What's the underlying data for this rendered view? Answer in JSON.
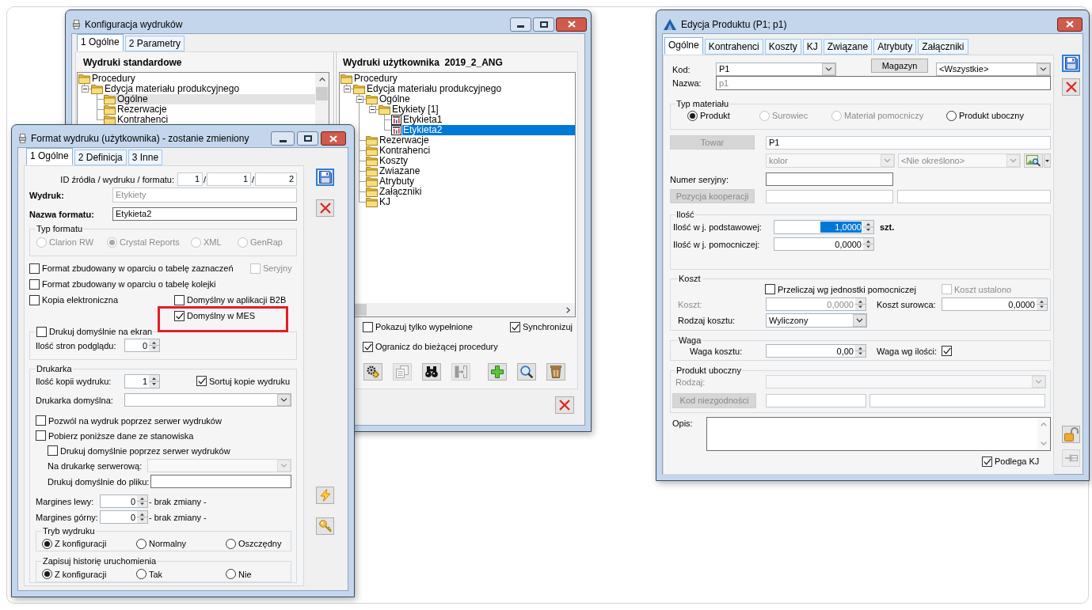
{
  "config_window": {
    "title": "Konfiguracja wydruków",
    "tabs": [
      {
        "label": "1 Ogólne",
        "selected": true
      },
      {
        "label": "2 Parametry",
        "selected": false
      }
    ],
    "standard_prints": {
      "title": "Wydruki standardowe",
      "focused": false,
      "tree": [
        {
          "label": "Procedury",
          "kind": "folder",
          "selected": false,
          "children": [
            {
              "label": "Edycja materiału produkcyjnego",
              "kind": "folder",
              "expanded": true,
              "selected": false,
              "children": [
                {
                  "label": "Ogólne",
                  "kind": "folder",
                  "selected": true
                },
                {
                  "label": "Rezerwacje",
                  "kind": "folder",
                  "selected": false
                },
                {
                  "label": "Kontrahenci",
                  "kind": "folder",
                  "selected": false
                }
              ]
            }
          ]
        }
      ]
    },
    "user_prints": {
      "title": "Wydruki użytkownika  2019_2_ANG",
      "focused": true,
      "tree": [
        {
          "label": "Procedury",
          "kind": "folder",
          "selected": false,
          "children": [
            {
              "label": "Edycja materiału produkcyjnego",
              "kind": "folder",
              "expanded": true,
              "selected": false,
              "children": [
                {
                  "label": "Ogólne",
                  "kind": "folder",
                  "expanded": true,
                  "selected": false,
                  "children": [
                    {
                      "label": "Etykiety [1]",
                      "kind": "folder",
                      "expanded": true,
                      "selected": false,
                      "children": [
                        {
                          "label": "Etykieta1",
                          "kind": "report",
                          "selected": false
                        },
                        {
                          "label": "Etykieta2",
                          "kind": "report",
                          "selected": true
                        }
                      ]
                    }
                  ]
                },
                {
                  "label": "Rezerwacje",
                  "kind": "folder",
                  "selected": false
                },
                {
                  "label": "Kontrahenci",
                  "kind": "folder",
                  "selected": false
                },
                {
                  "label": "Koszty",
                  "kind": "folder",
                  "selected": false
                },
                {
                  "label": "Zwiazane",
                  "kind": "folder",
                  "selected": false
                },
                {
                  "label": "Atrybuty",
                  "kind": "folder",
                  "selected": false
                },
                {
                  "label": "Załączniki",
                  "kind": "folder",
                  "selected": false
                },
                {
                  "label": "KJ",
                  "kind": "folder",
                  "selected": false
                }
              ]
            }
          ]
        }
      ]
    },
    "options": [
      {
        "label": "Pokazuj tylko wypełnione",
        "checked": false
      },
      {
        "label": "Synchronizuj",
        "checked": true
      },
      {
        "label": "Ogranicz do bieżącej procedury",
        "checked": true
      }
    ],
    "toolbar": [
      {
        "kind": "gears",
        "disabled": false
      },
      {
        "kind": "copy",
        "disabled": true
      },
      {
        "kind": "binoculars",
        "disabled": false
      },
      {
        "kind": "connect",
        "disabled": true
      },
      {
        "kind": "add",
        "disabled": false
      },
      {
        "kind": "search",
        "disabled": false
      },
      {
        "kind": "delete",
        "disabled": false
      }
    ]
  },
  "format_window": {
    "title": "Format wydruku (użytkownika) - zostanie zmieniony",
    "tabs": [
      {
        "label": "1 Ogólne",
        "selected": true
      },
      {
        "label": "2 Definicja",
        "selected": false
      },
      {
        "label": "3 Inne",
        "selected": false
      }
    ],
    "id": {
      "label": "ID źródła / wydruku / formatu:",
      "fields": [
        {
          "value": "1",
          "separator": "/"
        },
        {
          "value": "1",
          "separator": "/"
        },
        {
          "value": "2"
        }
      ]
    },
    "print": {
      "label": "Wydruk:",
      "value": "Etykiety",
      "disabled": true
    },
    "format_name": {
      "label": "Nazwa formatu:",
      "value": "Etykieta2",
      "disabled": false
    },
    "format_type": {
      "title": "Typ formatu",
      "disabled": true,
      "options": [
        {
          "label": "Clarion RW",
          "selected": false
        },
        {
          "label": "Crystal Reports",
          "selected": true
        },
        {
          "label": "XML",
          "selected": false
        },
        {
          "label": "GenRap",
          "selected": false
        }
      ]
    },
    "flags": [
      {
        "label": "Format zbudowany w oparciu o tabelę zaznaczeń",
        "checked": false,
        "disabled": false
      },
      {
        "label": "Seryjny",
        "checked": false,
        "disabled": true
      },
      {
        "label": "Format zbudowany w oparciu o tabelę kolejki",
        "checked": false,
        "disabled": false
      },
      {
        "label": "Kopia elektroniczna",
        "checked": false,
        "disabled": false
      },
      {
        "label": "Domyślny w aplikacji B2B",
        "checked": false,
        "disabled": false
      },
      {
        "label": "Domyślny w MES",
        "checked": true,
        "disabled": false,
        "highlighted": true
      }
    ],
    "screen": {
      "label": "Drukuj domyślnie na ekran",
      "checked": false,
      "pages_label": "Ilość stron podglądu:",
      "pages_value": "0"
    },
    "printer": {
      "title": "Drukarka",
      "copies_label": "Ilość kopii wydruku:",
      "copies_value": "1",
      "sort_copies": {
        "label": "Sortuj kopie wydruku",
        "checked": true
      },
      "default_printer_label": "Drukarka domyślna:",
      "server_options": [
        {
          "label": "Pozwól na wydruk poprzez serwer wydruków",
          "checked": false
        },
        {
          "label": "Pobierz poniższe dane ze stanowiska",
          "checked": false
        },
        {
          "label": "Drukuj domyślnie poprzez serwer wydruków",
          "checked": false
        }
      ],
      "server_printer": {
        "label": "Na drukarkę serwerową:",
        "disabled": true
      },
      "file_label": "Drukuj domyślnie do pliku:",
      "margins": [
        {
          "label": "Margines lewy:",
          "value": "0",
          "note": "- brak zmiany -"
        },
        {
          "label": "Margines górny:",
          "value": "0",
          "note": "- brak zmiany -"
        }
      ],
      "print_mode": {
        "title": "Tryb wydruku",
        "options": [
          {
            "label": "Z konfiguracji",
            "selected": true
          },
          {
            "label": "Normalny",
            "selected": false
          },
          {
            "label": "Oszczędny",
            "selected": false
          }
        ]
      },
      "run_history": {
        "title": "Zapisuj historię uruchomienia",
        "options": [
          {
            "label": "Z konfiguracji",
            "selected": true
          },
          {
            "label": "Tak",
            "selected": false
          },
          {
            "label": "Nie",
            "selected": false
          }
        ]
      }
    },
    "side_buttons": [
      {
        "kind": "save",
        "disabled": false
      },
      {
        "kind": "cancel",
        "disabled": false
      },
      {
        "kind": "bolt",
        "disabled": false
      },
      {
        "kind": "key",
        "disabled": false
      }
    ]
  },
  "product_window": {
    "title": "Edycja Produktu (P1; p1)",
    "tabs": [
      {
        "label": "Ogólne",
        "selected": true
      },
      {
        "label": "Kontrahenci",
        "selected": false
      },
      {
        "label": "Koszty",
        "selected": false
      },
      {
        "label": "KJ",
        "selected": false
      },
      {
        "label": "Związane",
        "selected": false
      },
      {
        "label": "Atrybuty",
        "selected": false
      },
      {
        "label": "Załączniki",
        "selected": false
      }
    ],
    "code": {
      "label": "Kod:",
      "value": "P1"
    },
    "warehouse_button": "Magazyn",
    "warehouse": "<Wszystkie>",
    "name": {
      "label": "Nazwa:",
      "value": "p1",
      "disabled": true
    },
    "material_type": {
      "title": "Typ materiału",
      "options": [
        {
          "label": "Produkt",
          "selected": true,
          "disabled": false
        },
        {
          "label": "Surowiec",
          "selected": false,
          "disabled": true
        },
        {
          "label": "Materiał pomocniczy",
          "selected": false,
          "disabled": true
        },
        {
          "label": "Produkt uboczny",
          "selected": false,
          "disabled": false
        }
      ]
    },
    "item": {
      "button": "Towar",
      "disabled": true,
      "value": "P1"
    },
    "feature": {
      "name": "kolor",
      "value": "<Nie określono>",
      "disabled": true
    },
    "serial_label": "Numer seryjny:",
    "cooperation": {
      "button": "Pozycja kooperacji",
      "disabled": true
    },
    "quantity": {
      "title": "Ilość",
      "base_label": "Ilość w j. podstawowej:",
      "base_value": "1,0000",
      "base_selected": true,
      "unit": "szt.",
      "aux_label": "Ilość w j. pomocniczej:",
      "aux_value": "0,0000"
    },
    "cost": {
      "title": "Koszt",
      "convert": {
        "label": "Przeliczaj wg jednostki pomocniczej",
        "checked": false,
        "disabled": false
      },
      "fixed": {
        "label": "Koszt ustalono",
        "checked": false,
        "disabled": true
      },
      "cost_label": "Koszt:",
      "cost_value": "0,0000",
      "cost_disabled": true,
      "raw_label": "Koszt surowca:",
      "raw_value": "0,0000",
      "type_label": "Rodzaj kosztu:",
      "type_value": "Wyliczony"
    },
    "weight": {
      "title": "Waga",
      "label": "Waga kosztu:",
      "value": "0,00",
      "by_quantity": {
        "label": "Waga wg ilości:",
        "checked": true
      }
    },
    "by_product": {
      "title": "Produkt uboczny",
      "type_label": "Rodzaj:",
      "disabled": true,
      "code_button": "Kod niezgodności"
    },
    "description_label": "Opis:",
    "quality_control": {
      "label": "Podlega KJ",
      "checked": true
    },
    "side_buttons": [
      {
        "kind": "save",
        "disabled": false
      },
      {
        "kind": "cancel",
        "disabled": false
      },
      {
        "kind": "lock",
        "disabled": false
      },
      {
        "kind": "pin",
        "disabled": true
      }
    ]
  }
}
